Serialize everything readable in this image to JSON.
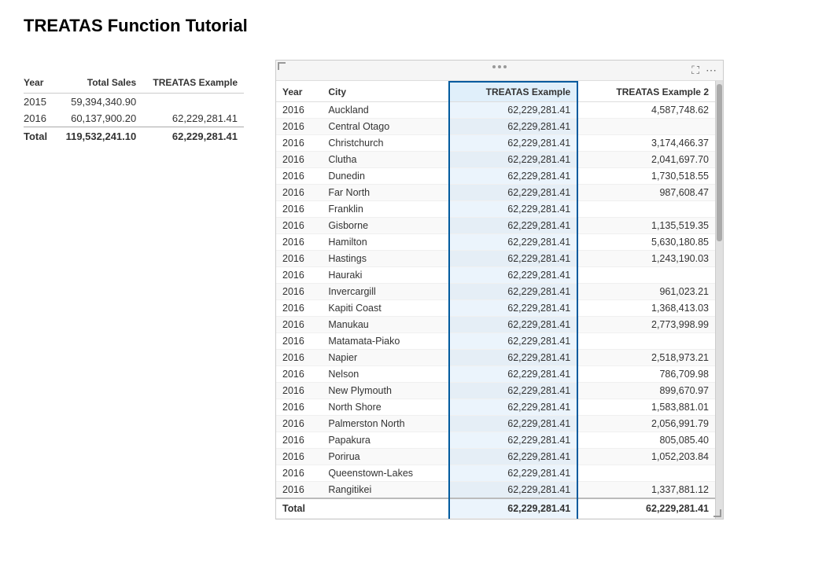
{
  "title": "TREATAS Function Tutorial",
  "left_table": {
    "headers": [
      "Year",
      "Total Sales",
      "TREATAS Example"
    ],
    "rows": [
      {
        "year": "2015",
        "total_sales": "59,394,340.90",
        "treatas": ""
      },
      {
        "year": "2016",
        "total_sales": "60,137,900.20",
        "treatas": "62,229,281.41"
      }
    ],
    "total": {
      "label": "Total",
      "total_sales": "119,532,241.10",
      "treatas": "62,229,281.41"
    }
  },
  "right_panel": {
    "columns": [
      "Year",
      "City",
      "TREATAS Example",
      "TREATAS Example 2"
    ],
    "rows": [
      {
        "year": "2016",
        "city": "Auckland",
        "treatas": "62,229,281.41",
        "treatas2": "4,587,748.62"
      },
      {
        "year": "2016",
        "city": "Central Otago",
        "treatas": "62,229,281.41",
        "treatas2": ""
      },
      {
        "year": "2016",
        "city": "Christchurch",
        "treatas": "62,229,281.41",
        "treatas2": "3,174,466.37"
      },
      {
        "year": "2016",
        "city": "Clutha",
        "treatas": "62,229,281.41",
        "treatas2": "2,041,697.70"
      },
      {
        "year": "2016",
        "city": "Dunedin",
        "treatas": "62,229,281.41",
        "treatas2": "1,730,518.55"
      },
      {
        "year": "2016",
        "city": "Far North",
        "treatas": "62,229,281.41",
        "treatas2": "987,608.47"
      },
      {
        "year": "2016",
        "city": "Franklin",
        "treatas": "62,229,281.41",
        "treatas2": ""
      },
      {
        "year": "2016",
        "city": "Gisborne",
        "treatas": "62,229,281.41",
        "treatas2": "1,135,519.35"
      },
      {
        "year": "2016",
        "city": "Hamilton",
        "treatas": "62,229,281.41",
        "treatas2": "5,630,180.85"
      },
      {
        "year": "2016",
        "city": "Hastings",
        "treatas": "62,229,281.41",
        "treatas2": "1,243,190.03"
      },
      {
        "year": "2016",
        "city": "Hauraki",
        "treatas": "62,229,281.41",
        "treatas2": ""
      },
      {
        "year": "2016",
        "city": "Invercargill",
        "treatas": "62,229,281.41",
        "treatas2": "961,023.21"
      },
      {
        "year": "2016",
        "city": "Kapiti Coast",
        "treatas": "62,229,281.41",
        "treatas2": "1,368,413.03"
      },
      {
        "year": "2016",
        "city": "Manukau",
        "treatas": "62,229,281.41",
        "treatas2": "2,773,998.99"
      },
      {
        "year": "2016",
        "city": "Matamata-Piako",
        "treatas": "62,229,281.41",
        "treatas2": ""
      },
      {
        "year": "2016",
        "city": "Napier",
        "treatas": "62,229,281.41",
        "treatas2": "2,518,973.21"
      },
      {
        "year": "2016",
        "city": "Nelson",
        "treatas": "62,229,281.41",
        "treatas2": "786,709.98"
      },
      {
        "year": "2016",
        "city": "New Plymouth",
        "treatas": "62,229,281.41",
        "treatas2": "899,670.97"
      },
      {
        "year": "2016",
        "city": "North Shore",
        "treatas": "62,229,281.41",
        "treatas2": "1,583,881.01"
      },
      {
        "year": "2016",
        "city": "Palmerston North",
        "treatas": "62,229,281.41",
        "treatas2": "2,056,991.79"
      },
      {
        "year": "2016",
        "city": "Papakura",
        "treatas": "62,229,281.41",
        "treatas2": "805,085.40"
      },
      {
        "year": "2016",
        "city": "Porirua",
        "treatas": "62,229,281.41",
        "treatas2": "1,052,203.84"
      },
      {
        "year": "2016",
        "city": "Queenstown-Lakes",
        "treatas": "62,229,281.41",
        "treatas2": ""
      },
      {
        "year": "2016",
        "city": "Rangitikei",
        "treatas": "62,229,281.41",
        "treatas2": "1,337,881.12"
      }
    ],
    "total": {
      "label": "Total",
      "treatas": "62,229,281.41",
      "treatas2": "62,229,281.41"
    }
  }
}
